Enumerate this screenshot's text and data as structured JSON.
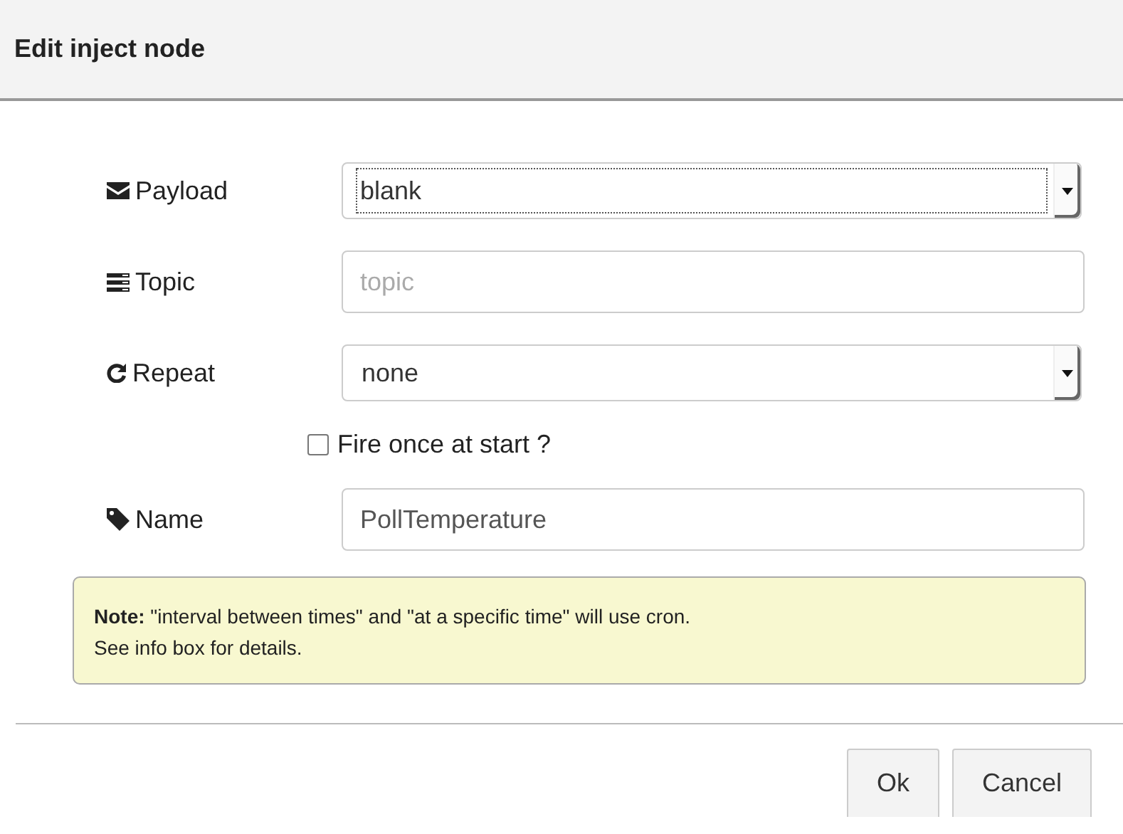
{
  "dialog": {
    "title": "Edit inject node"
  },
  "fields": [
    {
      "kind": "select",
      "label": "Payload",
      "value": "blank",
      "focused": true
    },
    {
      "kind": "text",
      "label": "Topic",
      "placeholder": "topic"
    },
    {
      "kind": "select",
      "label": "Repeat",
      "value": "none",
      "focused": false
    },
    {
      "kind": "checkbox",
      "label": "Fire once at start ?",
      "checked": false
    },
    {
      "kind": "text",
      "label": "Name",
      "value": "PollTemperature"
    }
  ],
  "note": "**Note:** \"interval between times\" and \"at a specific time\" will use cron.\nSee info box for details.",
  "buttons": [
    "Ok",
    "Cancel"
  ]
}
